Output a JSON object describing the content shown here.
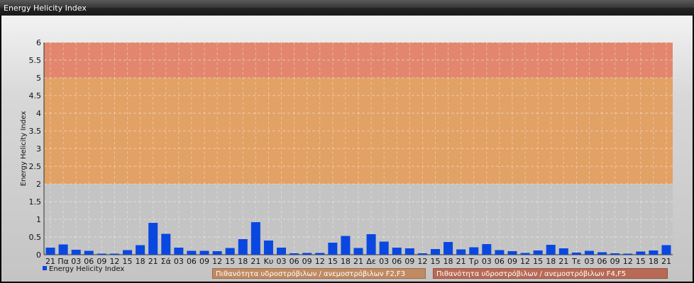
{
  "window": {
    "title": "Energy Helicity Index"
  },
  "colors": {
    "bar": "#0a47e0",
    "zone_high": "#e2876e",
    "zone_mid": "#e2a165",
    "plot_bg": "#c4c4c4"
  },
  "legend": {
    "series_label": "Energy Helicity Index"
  },
  "bands": [
    {
      "label": "Πιθανότητα υδροστρόβιλων / ανεμοστρόβιλων F2,F3",
      "from": 2,
      "to": 5
    },
    {
      "label": "Πιθανότητα υδροστρόβιλων / ανεμοστρόβιλων F4,F5",
      "from": 5,
      "to": 6
    }
  ],
  "chart_data": {
    "type": "bar",
    "ylabel": "Energy Helicity Index",
    "ylim": [
      0,
      6
    ],
    "yticks": [
      0,
      0.5,
      1,
      1.5,
      2,
      2.5,
      3,
      3.5,
      4,
      4.5,
      5,
      5.5,
      6
    ],
    "grid": true,
    "legend_position": "bottom-left",
    "categories": [
      "21",
      "Πα",
      "03",
      "06",
      "09",
      "12",
      "15",
      "18",
      "21",
      "Σά",
      "03",
      "06",
      "09",
      "12",
      "15",
      "18",
      "21",
      "Κυ",
      "03",
      "06",
      "09",
      "12",
      "15",
      "18",
      "21",
      "Δε",
      "03",
      "06",
      "09",
      "12",
      "15",
      "18",
      "21",
      "Τρ",
      "03",
      "06",
      "09",
      "12",
      "15",
      "18",
      "21",
      "Τε",
      "03",
      "06",
      "09",
      "12",
      "15",
      "18",
      "21"
    ],
    "series": [
      {
        "name": "Energy Helicity Index",
        "values": [
          0.2,
          0.29,
          0.14,
          0.11,
          0.03,
          0.03,
          0.13,
          0.27,
          0.9,
          0.59,
          0.2,
          0.11,
          0.11,
          0.1,
          0.19,
          0.44,
          0.92,
          0.4,
          0.2,
          0.04,
          0.05,
          0.05,
          0.34,
          0.53,
          0.19,
          0.58,
          0.37,
          0.2,
          0.18,
          0.04,
          0.16,
          0.36,
          0.15,
          0.21,
          0.3,
          0.13,
          0.1,
          0.05,
          0.12,
          0.28,
          0.18,
          0.06,
          0.11,
          0.07,
          0.04,
          0.03,
          0.09,
          0.12,
          0.27
        ]
      }
    ]
  }
}
